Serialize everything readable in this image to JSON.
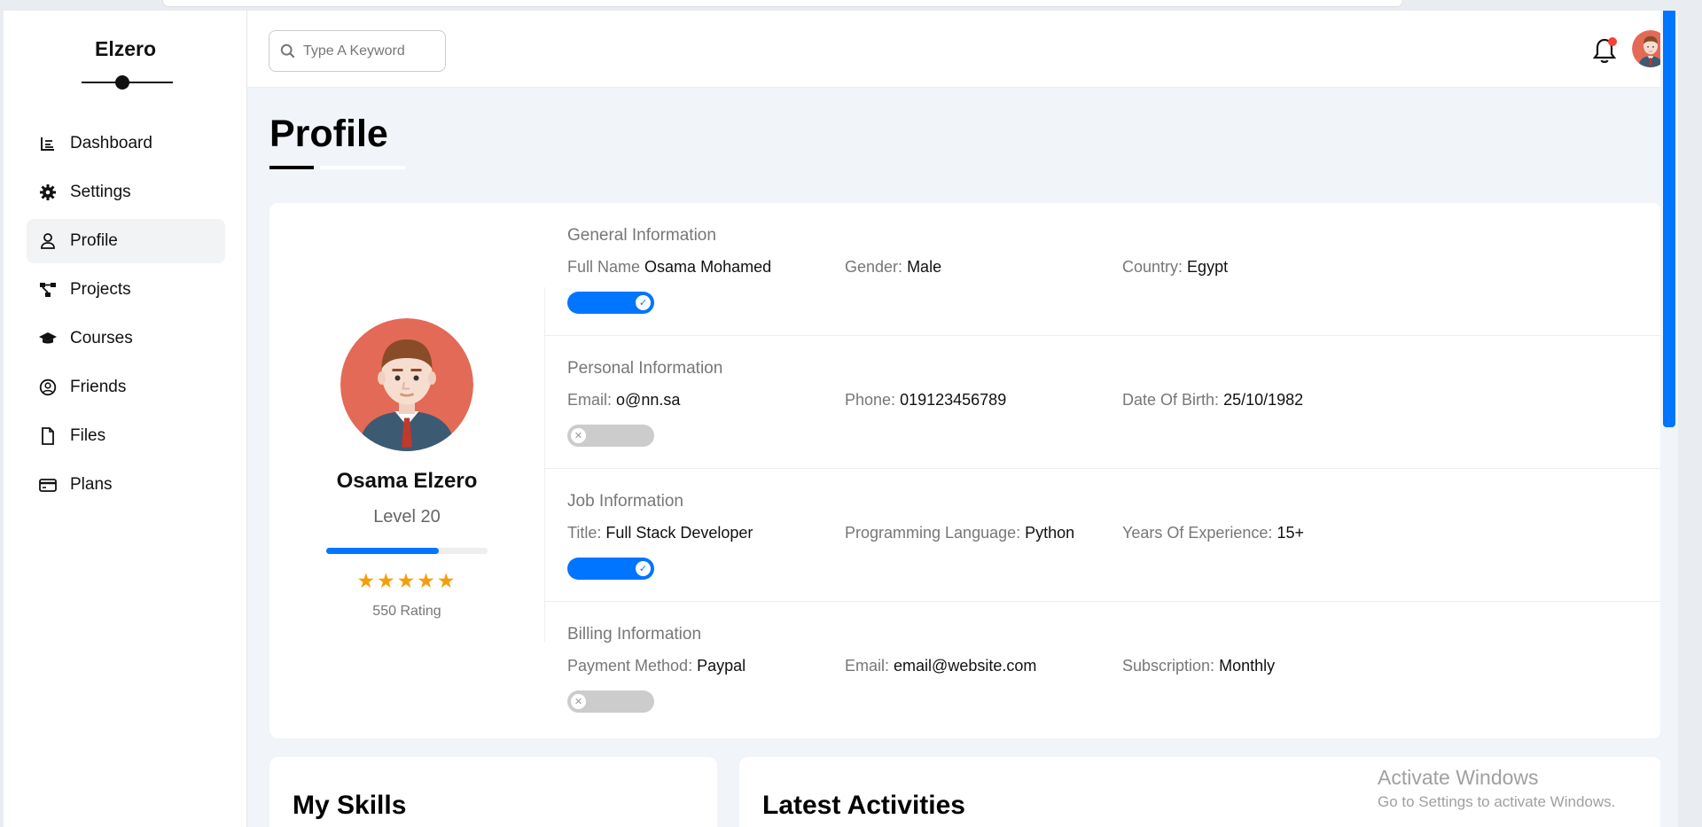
{
  "brand": "Elzero",
  "sidebar": {
    "items": [
      {
        "label": "Dashboard",
        "icon": "chart-icon"
      },
      {
        "label": "Settings",
        "icon": "gear-icon"
      },
      {
        "label": "Profile",
        "icon": "user-icon",
        "active": true
      },
      {
        "label": "Projects",
        "icon": "diagram-icon"
      },
      {
        "label": "Courses",
        "icon": "graduation-cap-icon"
      },
      {
        "label": "Friends",
        "icon": "user-circle-icon"
      },
      {
        "label": "Files",
        "icon": "file-icon"
      },
      {
        "label": "Plans",
        "icon": "credit-card-icon"
      }
    ]
  },
  "topbar": {
    "search_placeholder": "Type A Keyword",
    "notification_dot_color": "#f44336"
  },
  "page": {
    "title": "Profile"
  },
  "profile": {
    "name": "Osama Elzero",
    "level": "Level 20",
    "level_progress_pct": 70,
    "stars": "★★★★★",
    "star_count": 5,
    "rating": "550 Rating"
  },
  "info": [
    {
      "title": "General Information",
      "fields": [
        {
          "key": "Full Name",
          "value": "Osama Mohamed"
        },
        {
          "key": "Gender:",
          "value": "Male"
        },
        {
          "key": "Country:",
          "value": "Egypt"
        }
      ],
      "toggle": "on"
    },
    {
      "title": "Personal Information",
      "fields": [
        {
          "key": "Email:",
          "value": "o@nn.sa"
        },
        {
          "key": "Phone:",
          "value": "019123456789"
        },
        {
          "key": "Date Of Birth:",
          "value": "25/10/1982"
        }
      ],
      "toggle": "off"
    },
    {
      "title": "Job Information",
      "fields": [
        {
          "key": "Title:",
          "value": "Full Stack Developer"
        },
        {
          "key": "Programming Language:",
          "value": "Python"
        },
        {
          "key": "Years Of Experience:",
          "value": "15+"
        }
      ],
      "toggle": "on"
    },
    {
      "title": "Billing Information",
      "fields": [
        {
          "key": "Payment Method:",
          "value": "Paypal"
        },
        {
          "key": "Email:",
          "value": "email@website.com"
        },
        {
          "key": "Subscription:",
          "value": "Monthly"
        }
      ],
      "toggle": "off"
    }
  ],
  "sections": {
    "skills_title": "My Skills",
    "activities_title": "Latest Activities"
  },
  "watermark": {
    "line1": "Activate Windows",
    "line2": "Go to Settings to activate Windows."
  },
  "colors": {
    "accent": "#0075ff",
    "star": "#f59e0b",
    "background": "#f1f5f9"
  }
}
